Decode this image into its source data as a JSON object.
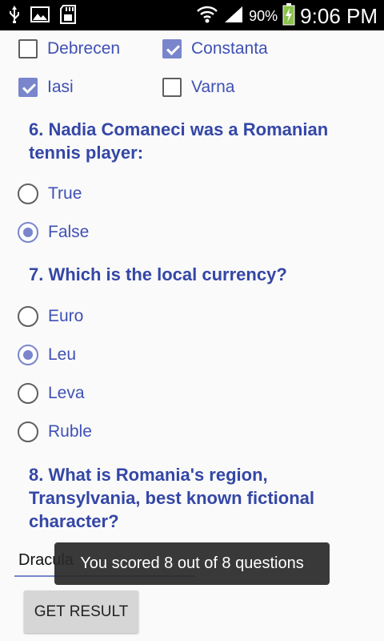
{
  "statusbar": {
    "battery_percent": "90%",
    "time": "9:06 PM"
  },
  "checkboxes": [
    {
      "label": "Debrecen",
      "checked": false
    },
    {
      "label": "Constanta",
      "checked": true
    },
    {
      "label": "Iasi",
      "checked": true
    },
    {
      "label": "Varna",
      "checked": false
    }
  ],
  "q6": {
    "text": "6. Nadia Comaneci was a Romanian tennis player:",
    "options": [
      {
        "label": "True",
        "selected": false
      },
      {
        "label": "False",
        "selected": true
      }
    ]
  },
  "q7": {
    "text": "7. Which is the local currency?",
    "options": [
      {
        "label": "Euro",
        "selected": false
      },
      {
        "label": "Leu",
        "selected": true
      },
      {
        "label": "Leva",
        "selected": false
      },
      {
        "label": "Ruble",
        "selected": false
      }
    ]
  },
  "q8": {
    "text": "8. What is Romania's region, Transylvania, best known fictional character?",
    "answer": "Dracula"
  },
  "button": {
    "label": "GET RESULT"
  },
  "toast": {
    "text": "You scored 8 out of 8 questions"
  },
  "colors": {
    "accent": "#7986cb",
    "question": "#3447a6",
    "label": "#3f51b5"
  }
}
